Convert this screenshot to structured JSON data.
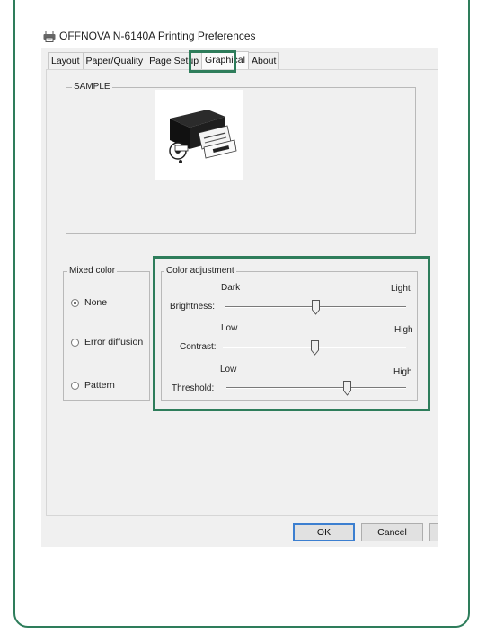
{
  "window": {
    "title": "OFFNOVA N-6140A Printing Preferences",
    "icon": "printer-icon"
  },
  "tabs": [
    {
      "label": "Layout",
      "active": false
    },
    {
      "label": "Paper/Quality",
      "active": false
    },
    {
      "label": "Page Setup",
      "active": false
    },
    {
      "label": "Graphical",
      "active": true
    },
    {
      "label": "About",
      "active": false
    }
  ],
  "sample": {
    "label": "SAMPLE"
  },
  "mixed_color": {
    "label": "Mixed color",
    "options": [
      {
        "label": "None",
        "checked": true
      },
      {
        "label": "Error diffusion",
        "checked": false
      },
      {
        "label": "Pattern",
        "checked": false
      }
    ]
  },
  "color_adjustment": {
    "label": "Color adjustment",
    "brightness": {
      "label": "Brightness:",
      "low": "Dark",
      "high": "Light",
      "value": 0.5
    },
    "contrast": {
      "label": "Contrast:",
      "low": "Low",
      "high": "High",
      "value": 0.5
    },
    "threshold": {
      "label": "Threshold:",
      "low": "Low",
      "high": "High",
      "value": 0.68
    }
  },
  "buttons": {
    "ok": "OK",
    "cancel": "Cancel"
  },
  "colors": {
    "highlight": "#2e7d5b",
    "default_button_border": "#3c7fd0"
  }
}
